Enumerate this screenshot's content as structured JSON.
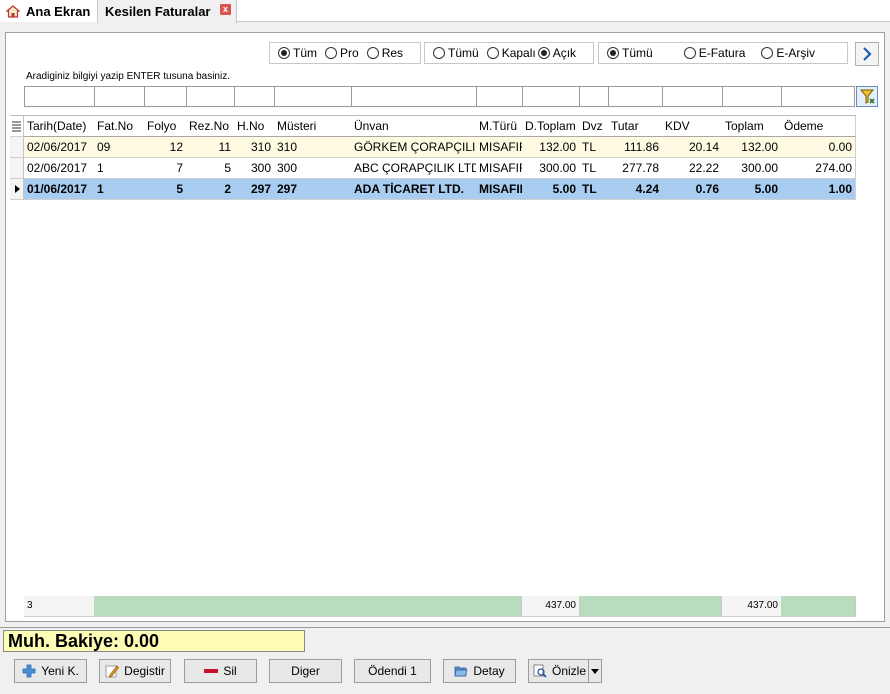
{
  "tabs": {
    "home_label": "Ana Ekran",
    "invoices_label": "Kesilen Faturalar",
    "close_glyph": "x"
  },
  "filters": {
    "group1": [
      {
        "label": "Tüm",
        "checked": true
      },
      {
        "label": "Pro",
        "checked": false
      },
      {
        "label": "Res",
        "checked": false
      }
    ],
    "group2": [
      {
        "label": "Tümü",
        "checked": false
      },
      {
        "label": "Kapalı",
        "checked": false
      },
      {
        "label": "Açık",
        "checked": true
      }
    ],
    "group3": [
      {
        "label": "Tümü",
        "checked": true
      },
      {
        "label": "E-Fatura",
        "checked": false
      },
      {
        "label": "E-Arşiv",
        "checked": false
      }
    ]
  },
  "search_hint": "Aradiginiz bilgiyi yazip ENTER tusuna basiniz.",
  "grid": {
    "columns": [
      "Tarih(Date)",
      "Fat.No",
      "Folyo",
      "Rez.No",
      "H.No",
      "Müsteri",
      "Ünvan",
      "M.Türü",
      "D.Toplam",
      "Dvz",
      "Tutar",
      "KDV",
      "Toplam",
      "Ödeme"
    ],
    "rows": [
      [
        "02/06/2017",
        "09",
        "12",
        "11",
        "310",
        "310",
        "GÖRKEM ÇORAPÇILIK",
        "MISAFIR",
        "132.00",
        "TL",
        "111.86",
        "20.14",
        "132.00",
        "0.00"
      ],
      [
        "02/06/2017",
        "1",
        "7",
        "5",
        "300",
        "300",
        "ABC ÇORAPÇILIK LTD",
        "MISAFIR",
        "300.00",
        "TL",
        "277.78",
        "22.22",
        "300.00",
        "274.00"
      ],
      [
        "01/06/2017",
        "1",
        "5",
        "2",
        "297",
        "297",
        "ADA TİCARET LTD.",
        "MISAFIR",
        "5.00",
        "TL",
        "4.24",
        "0.76",
        "5.00",
        "1.00"
      ]
    ],
    "selected_row": 2
  },
  "summary": {
    "count": "3",
    "d_toplam": "437.00",
    "toplam": "437.00"
  },
  "balance": "Muh. Bakiye: 0.00",
  "buttons": {
    "new": "Yeni K.",
    "edit": "Degistir",
    "delete": "Sil",
    "other": "Diger",
    "paid": "Ödendi 1",
    "detail": "Detay",
    "preview": "Önizle"
  },
  "colors": {
    "selected_row": "#a9cdf0",
    "odd_row": "#fffbe3",
    "summary": "#b9dcbf",
    "balance_bg": "#fdfcb4"
  }
}
